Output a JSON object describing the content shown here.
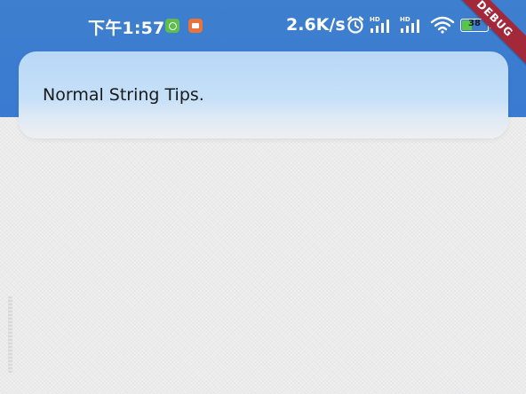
{
  "status_bar": {
    "time": "下午1:57",
    "network_speed": "2.6K/s",
    "battery_level": "38",
    "battery_fraction": 0.38,
    "icons": [
      "wechat-icon",
      "video-app-icon",
      "alarm-icon",
      "hd-signal-icon",
      "hd-signal-icon",
      "wifi-icon",
      "battery-icon"
    ]
  },
  "debug_banner": {
    "label": "DEBUG"
  },
  "toast": {
    "message": "Normal String Tips."
  },
  "colors": {
    "app_bar": "#3a7ad0",
    "toast_background": "#c6e0f8",
    "debug_ribbon": "#a3283a",
    "battery_fill": "#57c64c",
    "page_background": "#efeff0"
  }
}
